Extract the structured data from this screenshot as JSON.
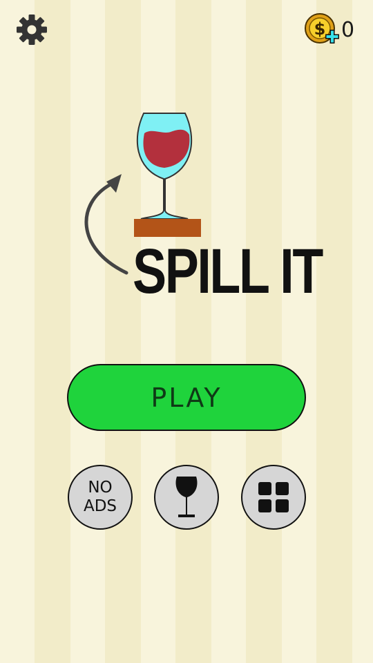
{
  "header": {
    "settings_icon": "gear-icon",
    "coin_icon": "coin-plus-icon",
    "coin_count": "0"
  },
  "logo": {
    "title": "SPILL IT",
    "art_icons": [
      "wine-glass-icon",
      "curved-arrow-icon",
      "table-icon"
    ],
    "colors": {
      "wine": "#b3303d",
      "glass": "#7ff0f4",
      "table": "#b35418"
    }
  },
  "play": {
    "label": "PLAY",
    "color": "#1fd33c"
  },
  "bottom_buttons": {
    "no_ads_label": "NO\nADS",
    "glass_icon": "wine-glass-icon",
    "levels_icon": "grid-icon"
  }
}
